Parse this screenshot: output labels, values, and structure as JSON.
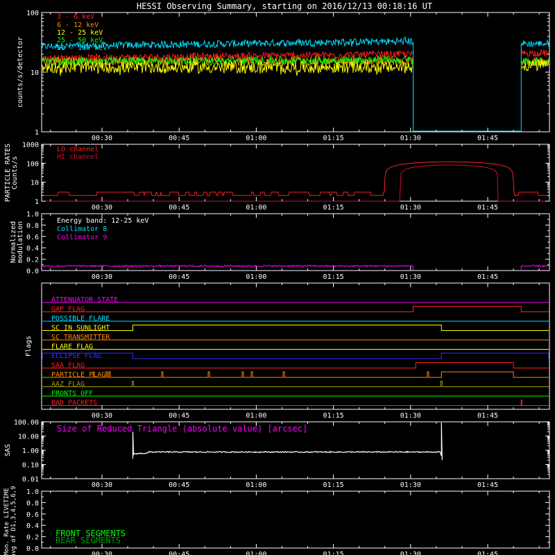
{
  "title": "HESSI Observing Summary, starting on 2016/12/13 00:18:16 UT",
  "time_ticks": [
    "00:30",
    "00:45",
    "01:00",
    "01:15",
    "01:30",
    "01:45"
  ],
  "colors": {
    "red": "#ff2020",
    "orange": "#ff8c00",
    "yellow": "#ffff00",
    "green": "#00ff00",
    "cyan": "#00e0ff",
    "magenta": "#ff00ff",
    "crimson": "#d0103a",
    "blue": "#3030ff",
    "olive": "#a0a000",
    "white": "#ffffff",
    "darkgreen": "#00a000"
  },
  "chart_data": [
    {
      "type": "line",
      "id": "count-rates",
      "ylabel": "counts/s/detector",
      "yscale": "log",
      "ylim": [
        1,
        100
      ],
      "yticks": [
        "1",
        "10",
        "100"
      ],
      "xlim": [
        "00:18:16",
        "01:57"
      ],
      "data_gap": [
        "01:30:30",
        "01:51:30"
      ],
      "series": [
        {
          "name": "3 - 6 keV",
          "color": "#ff2020",
          "level": 17,
          "trend": 17,
          "end": 20,
          "after_gap": 21,
          "noise": 0.06
        },
        {
          "name": "6 - 12 keV",
          "color": "#ff8c00",
          "level": 15,
          "trend": 15,
          "end": 15,
          "after_gap": 15,
          "noise": 0.07
        },
        {
          "name": "12 - 25 keV",
          "color": "#ffff00",
          "level": 12,
          "trend": 12,
          "end": 12,
          "after_gap": 13,
          "noise": 0.1
        },
        {
          "name": "25 - 50 keV",
          "color": "#00ff00",
          "level": 15,
          "trend": 15,
          "end": 16,
          "after_gap": 15,
          "noise": 0.07
        },
        {
          "name": "50 - 100 keV",
          "color": "#00e0ff",
          "level": 27,
          "trend": 26,
          "end": 33,
          "after_gap": 30,
          "noise": 0.06
        }
      ]
    },
    {
      "type": "line",
      "id": "particle-rates",
      "ylabel": "PARTICLE RATES",
      "ylabel2": "Counts/s",
      "yscale": "log",
      "ylim": [
        1,
        1000
      ],
      "yticks": [
        "1",
        "10",
        "100",
        "1000"
      ],
      "series": [
        {
          "name": "LO channel",
          "color": "#ff2020",
          "baseline": 2,
          "peak": 120
        },
        {
          "name": "HI channel",
          "color": "#d0103a",
          "baseline": 1,
          "peak": 80
        }
      ],
      "enhancement": {
        "start": "01:25",
        "peak": "01:40",
        "end": "01:50"
      }
    },
    {
      "type": "line",
      "id": "modulation",
      "ylabel": "Normalized",
      "ylabel2": "modulation",
      "ylim": [
        0,
        1.0
      ],
      "yticks": [
        "0.0",
        "0.2",
        "0.4",
        "0.6",
        "0.8",
        "1.0"
      ],
      "energy_label": "Energy band: 12-25 keV",
      "series": [
        {
          "name": "Collimator 8",
          "color": "#00e0ff",
          "level": 0.08
        },
        {
          "name": "Collimator 9",
          "color": "#ff00ff",
          "level": 0.08
        }
      ]
    },
    {
      "type": "line",
      "id": "flags",
      "ylabel": "Flags",
      "flags": [
        {
          "name": "ATTENUATOR STATE",
          "color": "#ff00ff",
          "on": []
        },
        {
          "name": "GAP FLAG",
          "color": "#ff2020",
          "on": [
            [
              "01:30:30",
              "01:51:30"
            ]
          ]
        },
        {
          "name": "POSSIBLE FLARE",
          "color": "#00e0ff",
          "on": []
        },
        {
          "name": "SC IN SUNLIGHT",
          "color": "#ffff00",
          "on": [
            [
              "00:36",
              "01:36"
            ]
          ]
        },
        {
          "name": "SC TRANSMITTER",
          "color": "#ff8c00",
          "on": []
        },
        {
          "name": "FLARE FLAG",
          "color": "#ffff00",
          "on": []
        },
        {
          "name": "ECLIPSE FLAG",
          "color": "#3030ff",
          "on": [
            [
              "00:18:16",
              "00:36"
            ],
            [
              "01:36",
              "01:57"
            ]
          ]
        },
        {
          "name": "SAA FLAG",
          "color": "#ff2020",
          "on": [
            [
              "01:31",
              "01:50"
            ]
          ]
        },
        {
          "name": "PARTICLE FLAG",
          "color": "#ff8c00",
          "on": []
        },
        {
          "name": "AAZ FLAG",
          "color": "#a0a000",
          "on": []
        },
        {
          "name": "FRONTS OFF",
          "color": "#00ff00",
          "on": []
        },
        {
          "name": "BAD PACKETS",
          "color": "#ff2020",
          "on": []
        }
      ]
    },
    {
      "type": "line",
      "id": "sas",
      "ylabel": "SAS",
      "yscale": "log",
      "ylim": [
        0.01,
        100
      ],
      "yticks": [
        "0.01",
        "0.10",
        "1.00",
        "10.00",
        "100.00"
      ],
      "annotation": "Size of Reduced Triangle (absolute value) [arcsec]",
      "series": [
        {
          "name": "SAS",
          "color": "#ffffff",
          "start": "00:36",
          "end": "01:36",
          "level": 0.75
        }
      ]
    },
    {
      "type": "line",
      "id": "livetime",
      "ylabel": "Mon. Rate LIVETIME",
      "ylabel2": "avg of D1,3,4,5,6,9",
      "ylim": [
        0,
        1.0
      ],
      "yticks": [
        "0.0",
        "0.2",
        "0.4",
        "0.6",
        "0.8",
        "1.0"
      ],
      "series": [
        {
          "name": "FRONT SEGMENTS",
          "color": "#00ff00"
        },
        {
          "name": "REAR SEGMENTS",
          "color": "#00a000"
        }
      ]
    }
  ]
}
